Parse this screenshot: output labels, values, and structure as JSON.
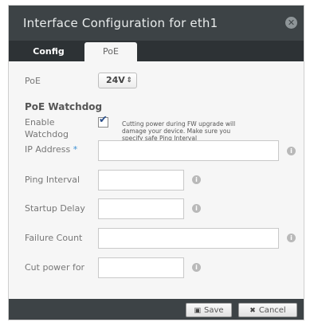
{
  "dialog": {
    "title": "Interface Configuration for eth1",
    "close_icon": "close-icon"
  },
  "tabs": [
    {
      "label": "Config",
      "active": false
    },
    {
      "label": "PoE",
      "active": true
    }
  ],
  "poe": {
    "label": "PoE",
    "value": "24V",
    "options_arrows": "⇕"
  },
  "watchdog": {
    "section_title": "PoE Watchdog",
    "enable_label_line1": "Enable",
    "enable_label_line2": "Watchdog",
    "enabled": true,
    "warning_line1": "Cutting power during FW upgrade will",
    "warning_line2": "damage your device. Make sure you",
    "warning_line3": "specify safe Ping Interval"
  },
  "fields": {
    "ip_address": {
      "label": "IP Address",
      "required_marker": "*",
      "value": ""
    },
    "ping_interval": {
      "label": "Ping Interval",
      "value": ""
    },
    "startup_delay": {
      "label": "Startup Delay",
      "value": ""
    },
    "failure_count": {
      "label": "Failure Count",
      "value": ""
    },
    "cut_power_for": {
      "label": "Cut power for",
      "value": ""
    }
  },
  "footer": {
    "save_label": "Save",
    "cancel_label": "Cancel"
  },
  "colors": {
    "titlebar": "#3d4346",
    "tabbar": "#2d3235",
    "required_marker": "#3b8fd3",
    "checkmark": "#2b4f8a"
  }
}
